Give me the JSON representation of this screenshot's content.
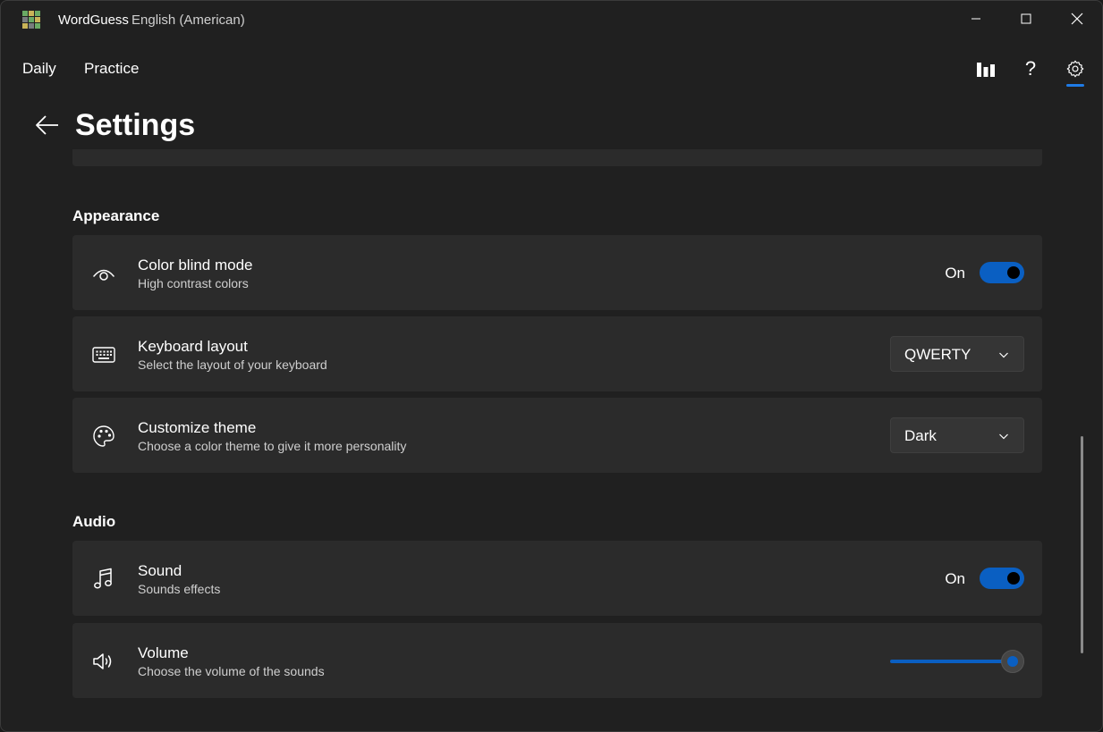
{
  "window": {
    "app_name": "WordGuess",
    "language": "English (American)",
    "logo_colors": [
      "#6aaa64",
      "#c9b458",
      "#6aaa64",
      "#787c7e",
      "#6aaa64",
      "#c9b458",
      "#c9b458",
      "#787c7e",
      "#6aaa64"
    ]
  },
  "nav": {
    "tabs": [
      {
        "label": "Daily"
      },
      {
        "label": "Practice"
      }
    ],
    "icons": [
      "stats-icon",
      "help-icon",
      "settings-icon"
    ],
    "help_glyph": "?"
  },
  "page": {
    "title": "Settings"
  },
  "sections": {
    "appearance": {
      "title": "Appearance",
      "color_blind": {
        "title": "Color blind mode",
        "desc": "High contrast colors",
        "state_label": "On",
        "on": true
      },
      "keyboard": {
        "title": "Keyboard layout",
        "desc": "Select the layout of your keyboard",
        "value": "QWERTY"
      },
      "theme": {
        "title": "Customize theme",
        "desc": "Choose a color theme to give it more personality",
        "value": "Dark"
      }
    },
    "audio": {
      "title": "Audio",
      "sound": {
        "title": "Sound",
        "desc": "Sounds effects",
        "state_label": "On",
        "on": true
      },
      "volume": {
        "title": "Volume",
        "desc": "Choose the volume of the sounds",
        "level_percent": 100
      }
    }
  },
  "colors": {
    "accent": "#0a5fc2",
    "card_bg": "#2b2b2b",
    "window_bg": "#202020"
  }
}
